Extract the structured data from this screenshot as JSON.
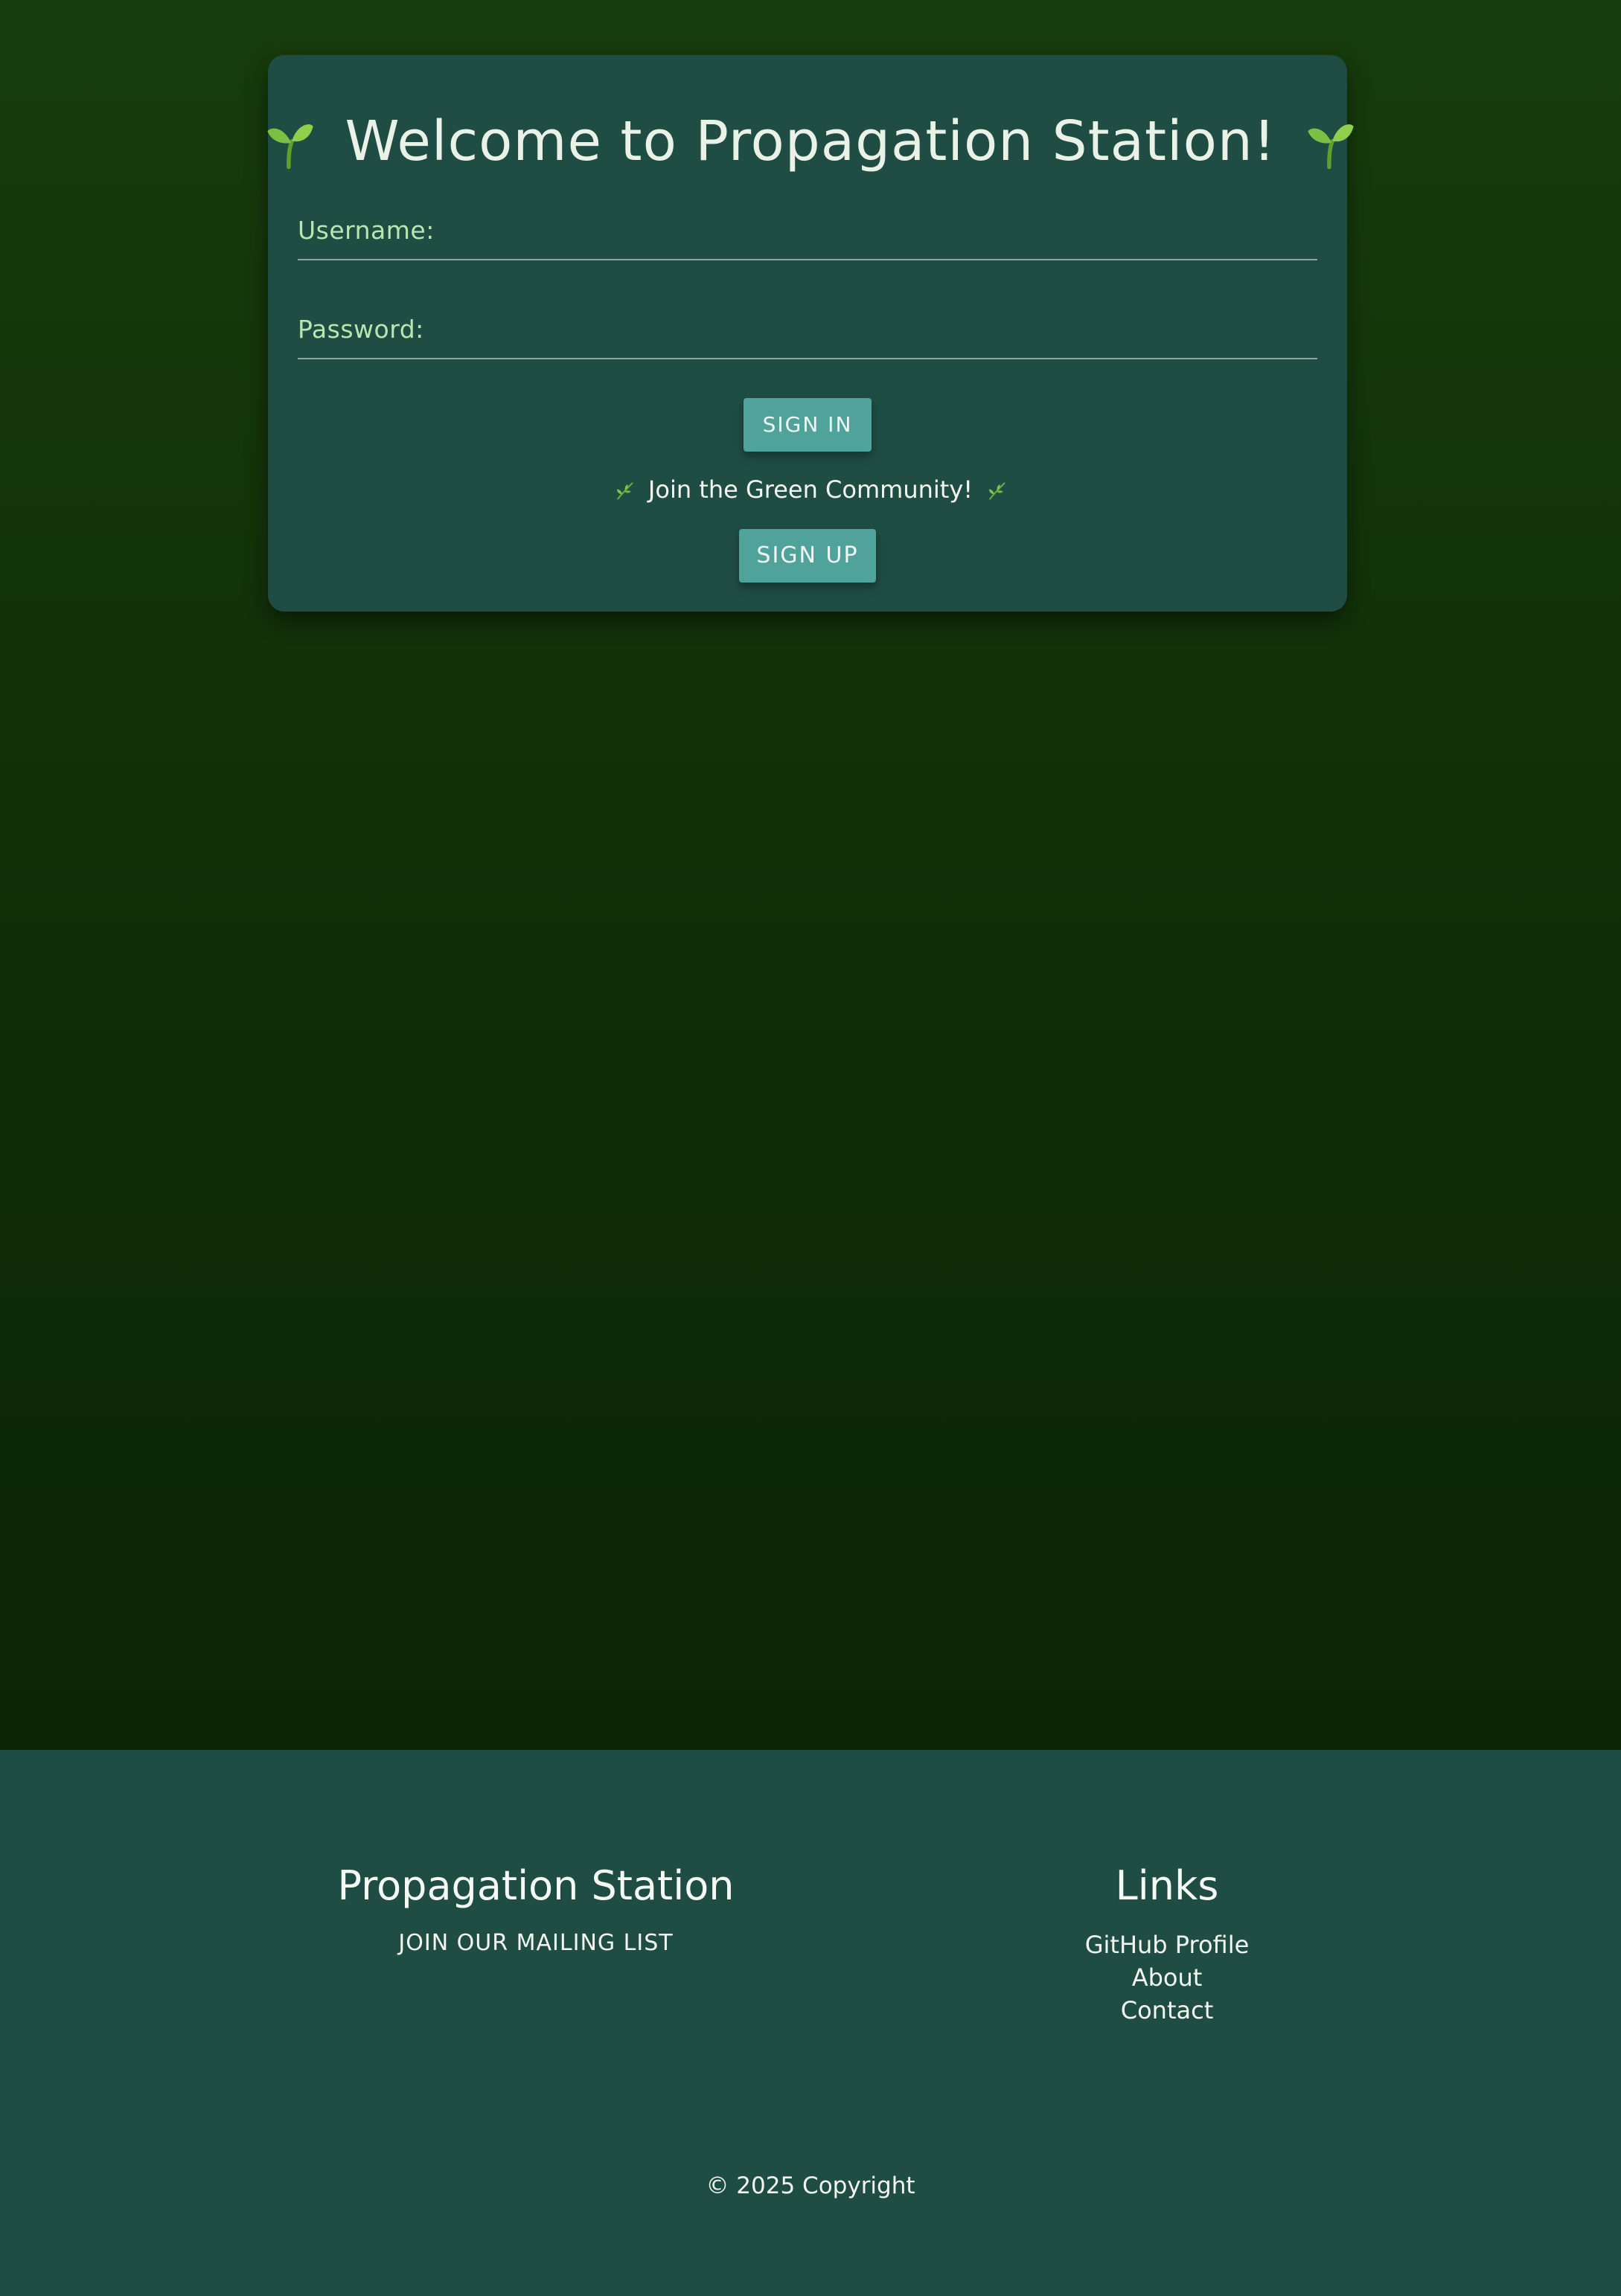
{
  "login": {
    "title": "Welcome to Propagation Station!",
    "username_label": "Username:",
    "password_label": "Password:",
    "signin_label": "SIGN IN",
    "community_text": "Join the Green Community!",
    "signup_label": "SIGN UP",
    "username_value": "",
    "password_value": ""
  },
  "footer": {
    "brand_heading": "Propagation Station",
    "mailing_label": "JOIN OUR MAILING LIST",
    "links_heading": "Links",
    "links": [
      {
        "label": "GitHub Profile"
      },
      {
        "label": "About"
      },
      {
        "label": "Contact"
      }
    ],
    "copyright": "© 2025 Copyright"
  },
  "icons": {
    "title_icon": "seedling-icon",
    "community_icon": "herb-icon"
  },
  "colors": {
    "background_top": "#173c0c",
    "background_bottom": "#0b2604",
    "card": "#1f4d44",
    "button": "#4fa39a",
    "label": "#b8e6b0"
  }
}
